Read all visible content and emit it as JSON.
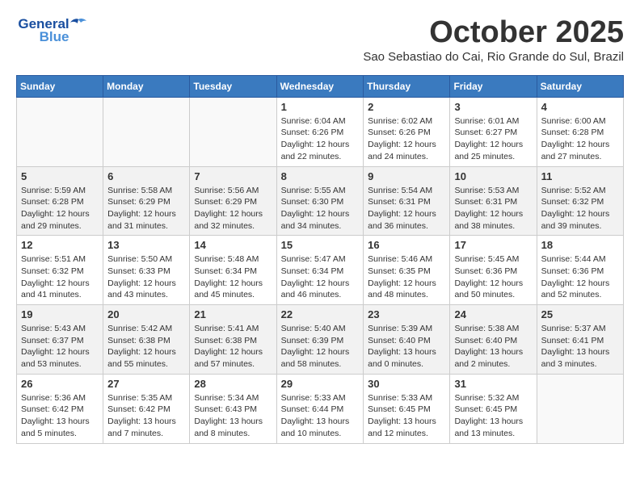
{
  "logo": {
    "part1": "General",
    "part2": "Blue"
  },
  "title": "October 2025",
  "subtitle": "Sao Sebastiao do Cai, Rio Grande do Sul, Brazil",
  "days_of_week": [
    "Sunday",
    "Monday",
    "Tuesday",
    "Wednesday",
    "Thursday",
    "Friday",
    "Saturday"
  ],
  "weeks": [
    {
      "shaded": false,
      "days": [
        {
          "num": "",
          "info": ""
        },
        {
          "num": "",
          "info": ""
        },
        {
          "num": "",
          "info": ""
        },
        {
          "num": "1",
          "info": "Sunrise: 6:04 AM\nSunset: 6:26 PM\nDaylight: 12 hours\nand 22 minutes."
        },
        {
          "num": "2",
          "info": "Sunrise: 6:02 AM\nSunset: 6:26 PM\nDaylight: 12 hours\nand 24 minutes."
        },
        {
          "num": "3",
          "info": "Sunrise: 6:01 AM\nSunset: 6:27 PM\nDaylight: 12 hours\nand 25 minutes."
        },
        {
          "num": "4",
          "info": "Sunrise: 6:00 AM\nSunset: 6:28 PM\nDaylight: 12 hours\nand 27 minutes."
        }
      ]
    },
    {
      "shaded": true,
      "days": [
        {
          "num": "5",
          "info": "Sunrise: 5:59 AM\nSunset: 6:28 PM\nDaylight: 12 hours\nand 29 minutes."
        },
        {
          "num": "6",
          "info": "Sunrise: 5:58 AM\nSunset: 6:29 PM\nDaylight: 12 hours\nand 31 minutes."
        },
        {
          "num": "7",
          "info": "Sunrise: 5:56 AM\nSunset: 6:29 PM\nDaylight: 12 hours\nand 32 minutes."
        },
        {
          "num": "8",
          "info": "Sunrise: 5:55 AM\nSunset: 6:30 PM\nDaylight: 12 hours\nand 34 minutes."
        },
        {
          "num": "9",
          "info": "Sunrise: 5:54 AM\nSunset: 6:31 PM\nDaylight: 12 hours\nand 36 minutes."
        },
        {
          "num": "10",
          "info": "Sunrise: 5:53 AM\nSunset: 6:31 PM\nDaylight: 12 hours\nand 38 minutes."
        },
        {
          "num": "11",
          "info": "Sunrise: 5:52 AM\nSunset: 6:32 PM\nDaylight: 12 hours\nand 39 minutes."
        }
      ]
    },
    {
      "shaded": false,
      "days": [
        {
          "num": "12",
          "info": "Sunrise: 5:51 AM\nSunset: 6:32 PM\nDaylight: 12 hours\nand 41 minutes."
        },
        {
          "num": "13",
          "info": "Sunrise: 5:50 AM\nSunset: 6:33 PM\nDaylight: 12 hours\nand 43 minutes."
        },
        {
          "num": "14",
          "info": "Sunrise: 5:48 AM\nSunset: 6:34 PM\nDaylight: 12 hours\nand 45 minutes."
        },
        {
          "num": "15",
          "info": "Sunrise: 5:47 AM\nSunset: 6:34 PM\nDaylight: 12 hours\nand 46 minutes."
        },
        {
          "num": "16",
          "info": "Sunrise: 5:46 AM\nSunset: 6:35 PM\nDaylight: 12 hours\nand 48 minutes."
        },
        {
          "num": "17",
          "info": "Sunrise: 5:45 AM\nSunset: 6:36 PM\nDaylight: 12 hours\nand 50 minutes."
        },
        {
          "num": "18",
          "info": "Sunrise: 5:44 AM\nSunset: 6:36 PM\nDaylight: 12 hours\nand 52 minutes."
        }
      ]
    },
    {
      "shaded": true,
      "days": [
        {
          "num": "19",
          "info": "Sunrise: 5:43 AM\nSunset: 6:37 PM\nDaylight: 12 hours\nand 53 minutes."
        },
        {
          "num": "20",
          "info": "Sunrise: 5:42 AM\nSunset: 6:38 PM\nDaylight: 12 hours\nand 55 minutes."
        },
        {
          "num": "21",
          "info": "Sunrise: 5:41 AM\nSunset: 6:38 PM\nDaylight: 12 hours\nand 57 minutes."
        },
        {
          "num": "22",
          "info": "Sunrise: 5:40 AM\nSunset: 6:39 PM\nDaylight: 12 hours\nand 58 minutes."
        },
        {
          "num": "23",
          "info": "Sunrise: 5:39 AM\nSunset: 6:40 PM\nDaylight: 13 hours\nand 0 minutes."
        },
        {
          "num": "24",
          "info": "Sunrise: 5:38 AM\nSunset: 6:40 PM\nDaylight: 13 hours\nand 2 minutes."
        },
        {
          "num": "25",
          "info": "Sunrise: 5:37 AM\nSunset: 6:41 PM\nDaylight: 13 hours\nand 3 minutes."
        }
      ]
    },
    {
      "shaded": false,
      "days": [
        {
          "num": "26",
          "info": "Sunrise: 5:36 AM\nSunset: 6:42 PM\nDaylight: 13 hours\nand 5 minutes."
        },
        {
          "num": "27",
          "info": "Sunrise: 5:35 AM\nSunset: 6:42 PM\nDaylight: 13 hours\nand 7 minutes."
        },
        {
          "num": "28",
          "info": "Sunrise: 5:34 AM\nSunset: 6:43 PM\nDaylight: 13 hours\nand 8 minutes."
        },
        {
          "num": "29",
          "info": "Sunrise: 5:33 AM\nSunset: 6:44 PM\nDaylight: 13 hours\nand 10 minutes."
        },
        {
          "num": "30",
          "info": "Sunrise: 5:33 AM\nSunset: 6:45 PM\nDaylight: 13 hours\nand 12 minutes."
        },
        {
          "num": "31",
          "info": "Sunrise: 5:32 AM\nSunset: 6:45 PM\nDaylight: 13 hours\nand 13 minutes."
        },
        {
          "num": "",
          "info": ""
        }
      ]
    }
  ]
}
